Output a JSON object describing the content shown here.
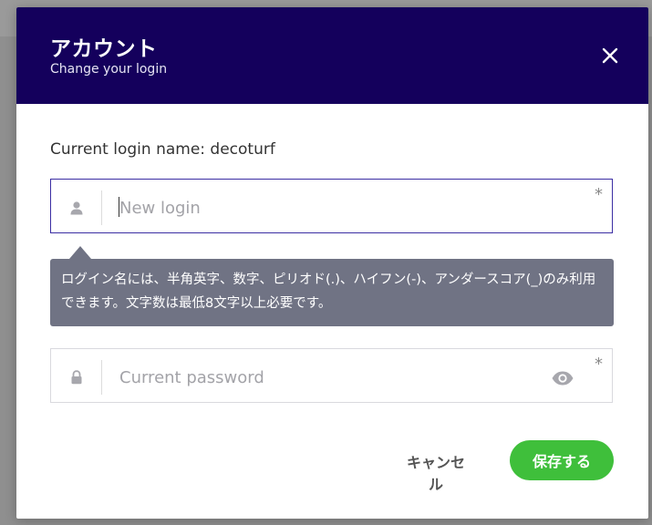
{
  "dialog": {
    "title": "アカウント",
    "subtitle": "Change your login"
  },
  "current_login_text": "Current login name: decoturf",
  "new_login": {
    "value": "",
    "placeholder": "New login",
    "required": "*",
    "icon": "user-icon"
  },
  "hint": "ログイン名には、半角英字、数字、ピリオド(.)、ハイフン(-)、アンダースコア(_)のみ利用できます。文字数は最低8文字以上必要です。",
  "password": {
    "value": "",
    "placeholder": "Current password",
    "required": "*",
    "icon": "lock-icon",
    "toggle_icon": "eye-icon"
  },
  "buttons": {
    "cancel": "キャンセル",
    "save": "保存する"
  },
  "colors": {
    "header": "#14005c",
    "save": "#3fbf3b",
    "tooltip": "#707384",
    "active_border": "#3b2ea3"
  }
}
